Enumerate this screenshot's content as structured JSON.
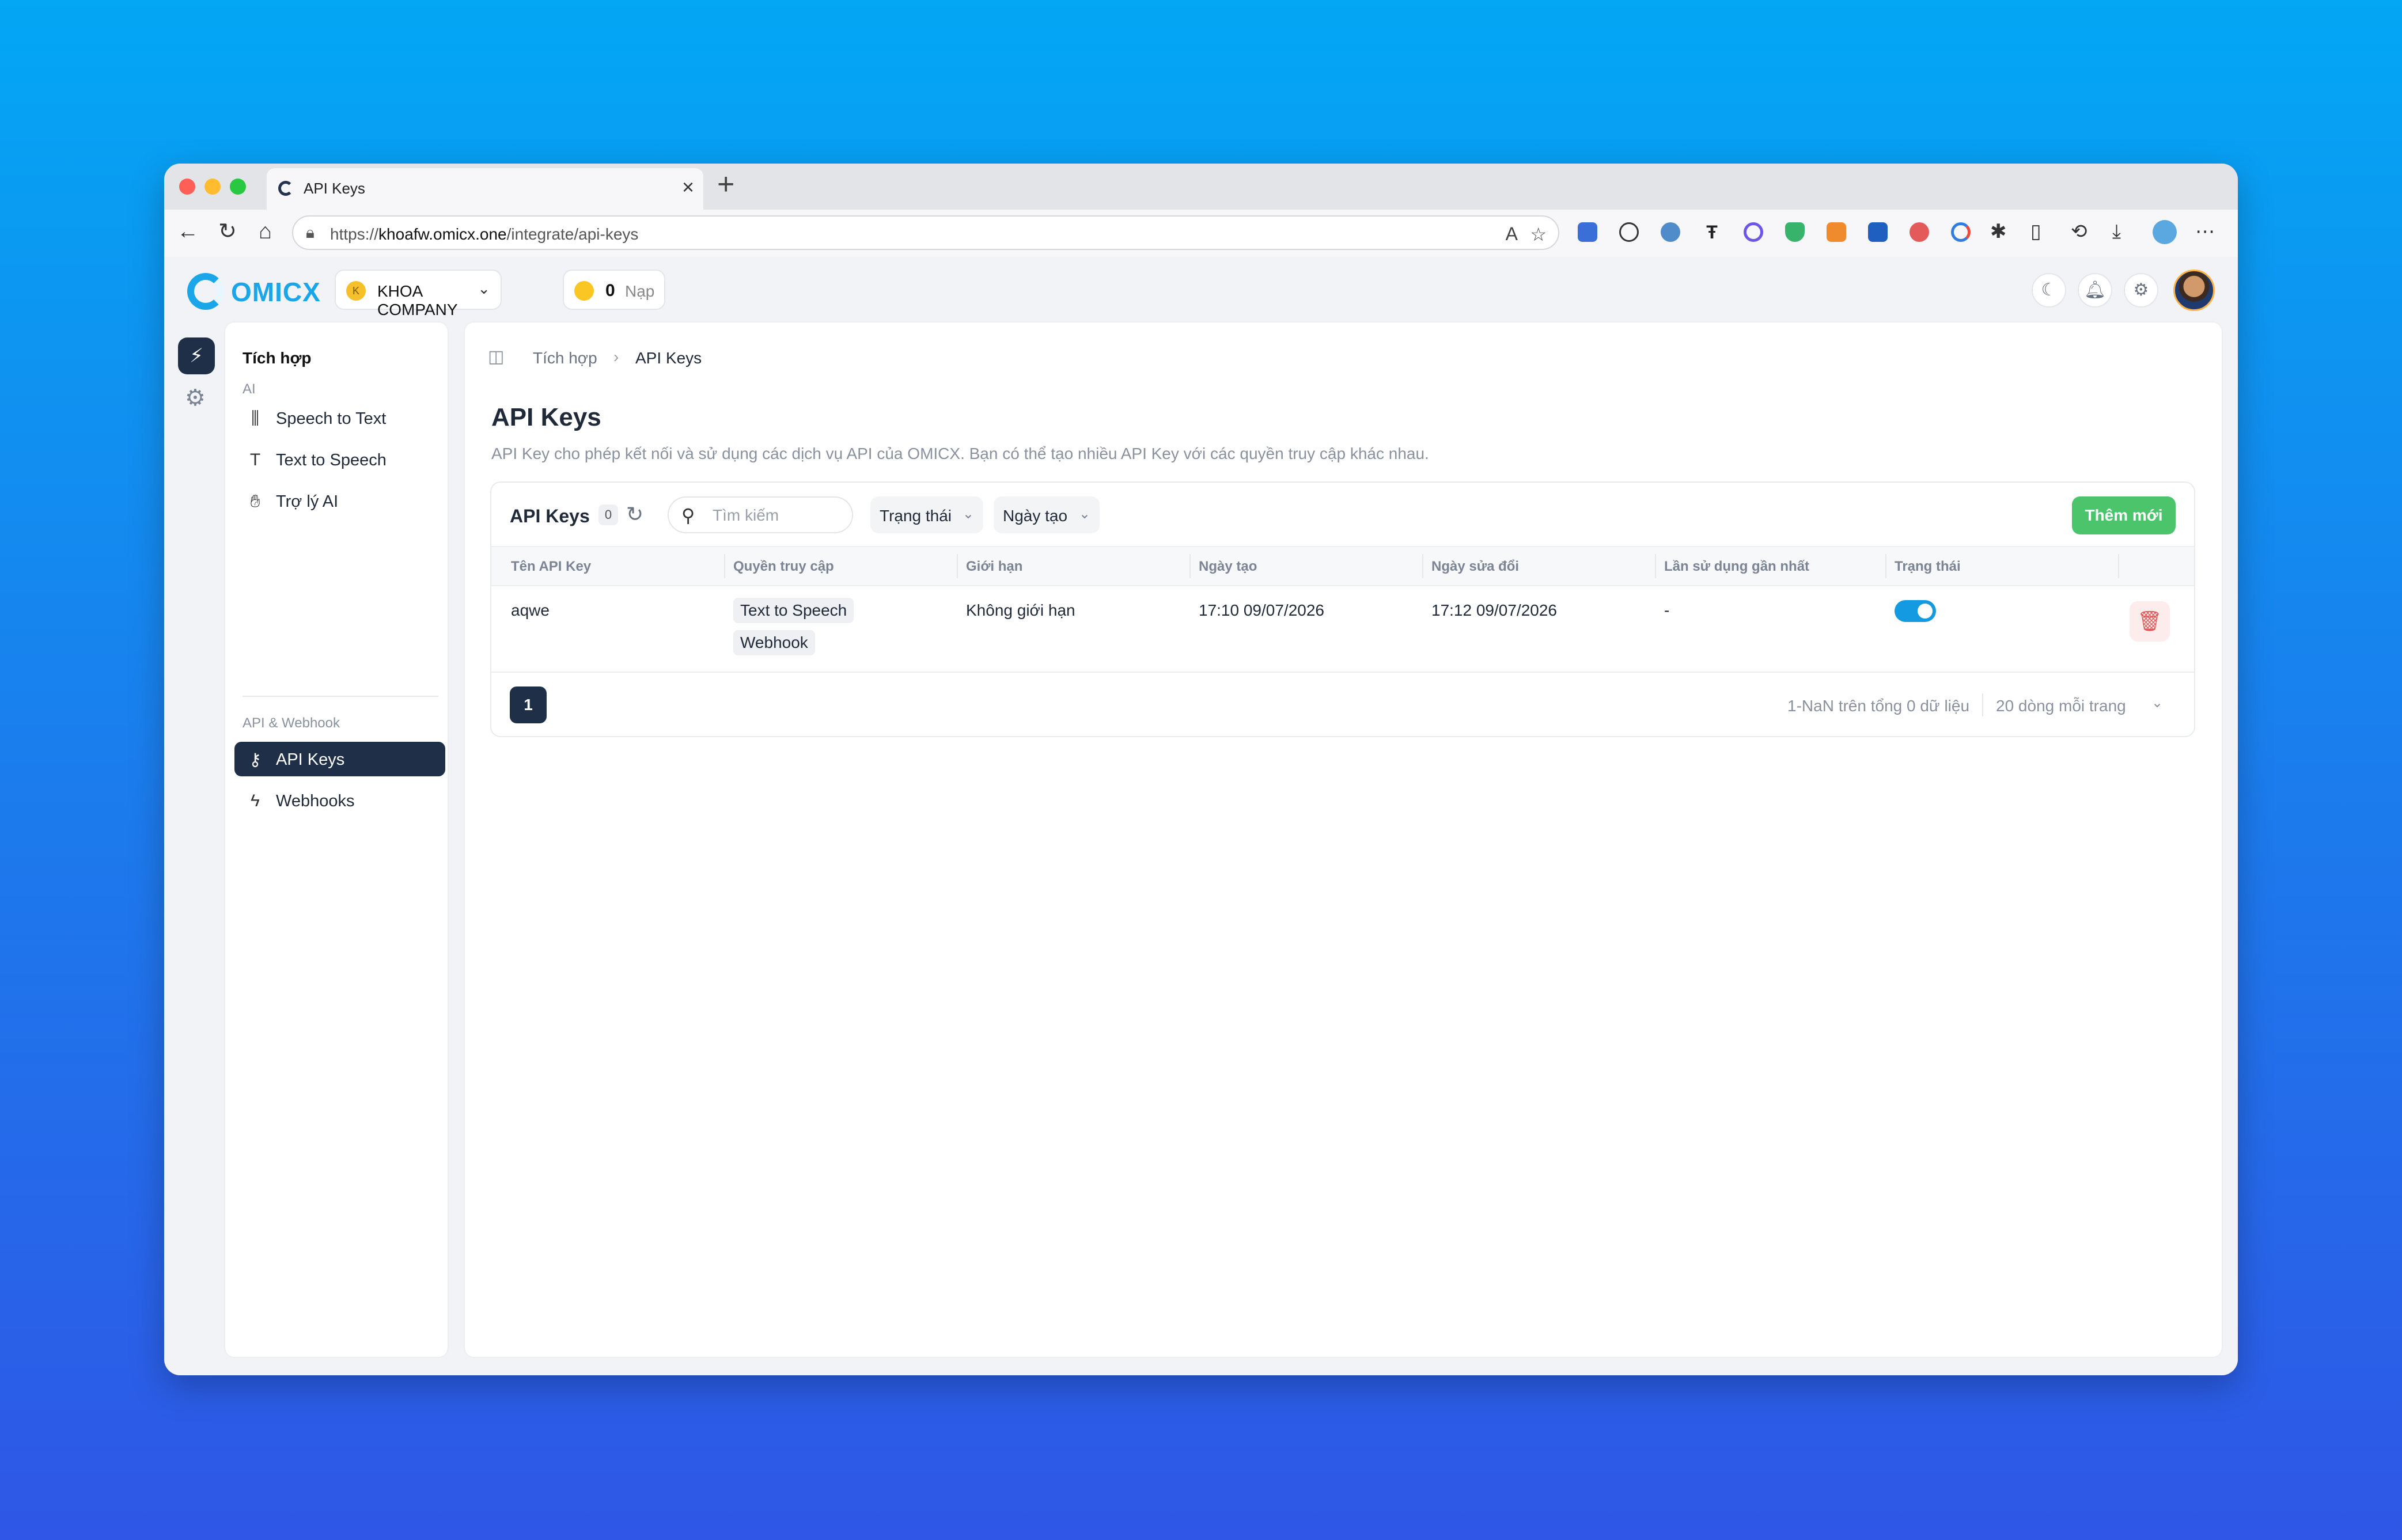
{
  "browser": {
    "tab_title": "API Keys",
    "url_prefix": "https://",
    "url_host": "khoafw.omicx.one",
    "url_path": "/integrate/api-keys"
  },
  "header": {
    "logo_text": "OMICX",
    "company_initial": "K",
    "company_name": "KHOA COMPANY",
    "credit_value": "0",
    "credit_label": "Nạp"
  },
  "sidebar": {
    "title": "Tích hợp",
    "group_ai": "AI",
    "group_api": "API & Webhook",
    "items": [
      {
        "label": "Speech to Text",
        "icon": "waveform-icon"
      },
      {
        "label": "Text to Speech",
        "icon": "text-icon"
      },
      {
        "label": "Trợ lý AI",
        "icon": "assistant-icon"
      },
      {
        "label": "API Keys",
        "icon": "key-icon"
      },
      {
        "label": "Webhooks",
        "icon": "webhook-icon"
      }
    ]
  },
  "breadcrumb": {
    "parent": "Tích hợp",
    "current": "API Keys"
  },
  "page": {
    "title": "API Keys",
    "description": "API Key cho phép kết nối và sử dụng các dịch vụ API của OMICX. Bạn có thể tạo nhiều API Key với các quyền truy cập khác nhau."
  },
  "card": {
    "title": "API Keys",
    "count": "0",
    "search_placeholder": "Tìm kiếm",
    "filter_status": "Trạng thái",
    "filter_created": "Ngày tạo",
    "add_button": "Thêm mới"
  },
  "table": {
    "columns": [
      "Tên API Key",
      "Quyền truy cập",
      "Giới hạn",
      "Ngày tạo",
      "Ngày sửa đổi",
      "Lần sử dụng gần nhất",
      "Trạng thái"
    ],
    "rows": [
      {
        "name": "aqwe",
        "permissions": [
          "Text to Speech",
          "Webhook"
        ],
        "limit": "Không giới hạn",
        "created": "17:10 09/07/2026",
        "modified": "17:12 09/07/2026",
        "last_used": "-",
        "status_enabled": true
      }
    ]
  },
  "pagination": {
    "current_page": "1",
    "info": "1-NaN trên tổng 0 dữ liệu",
    "page_size": "20 dòng mỗi trang"
  },
  "colors": {
    "accent": "#1f2f47",
    "primary_button": "#4cc46b",
    "toggle_on": "#139ae0",
    "brand": "#1aa6e8"
  }
}
